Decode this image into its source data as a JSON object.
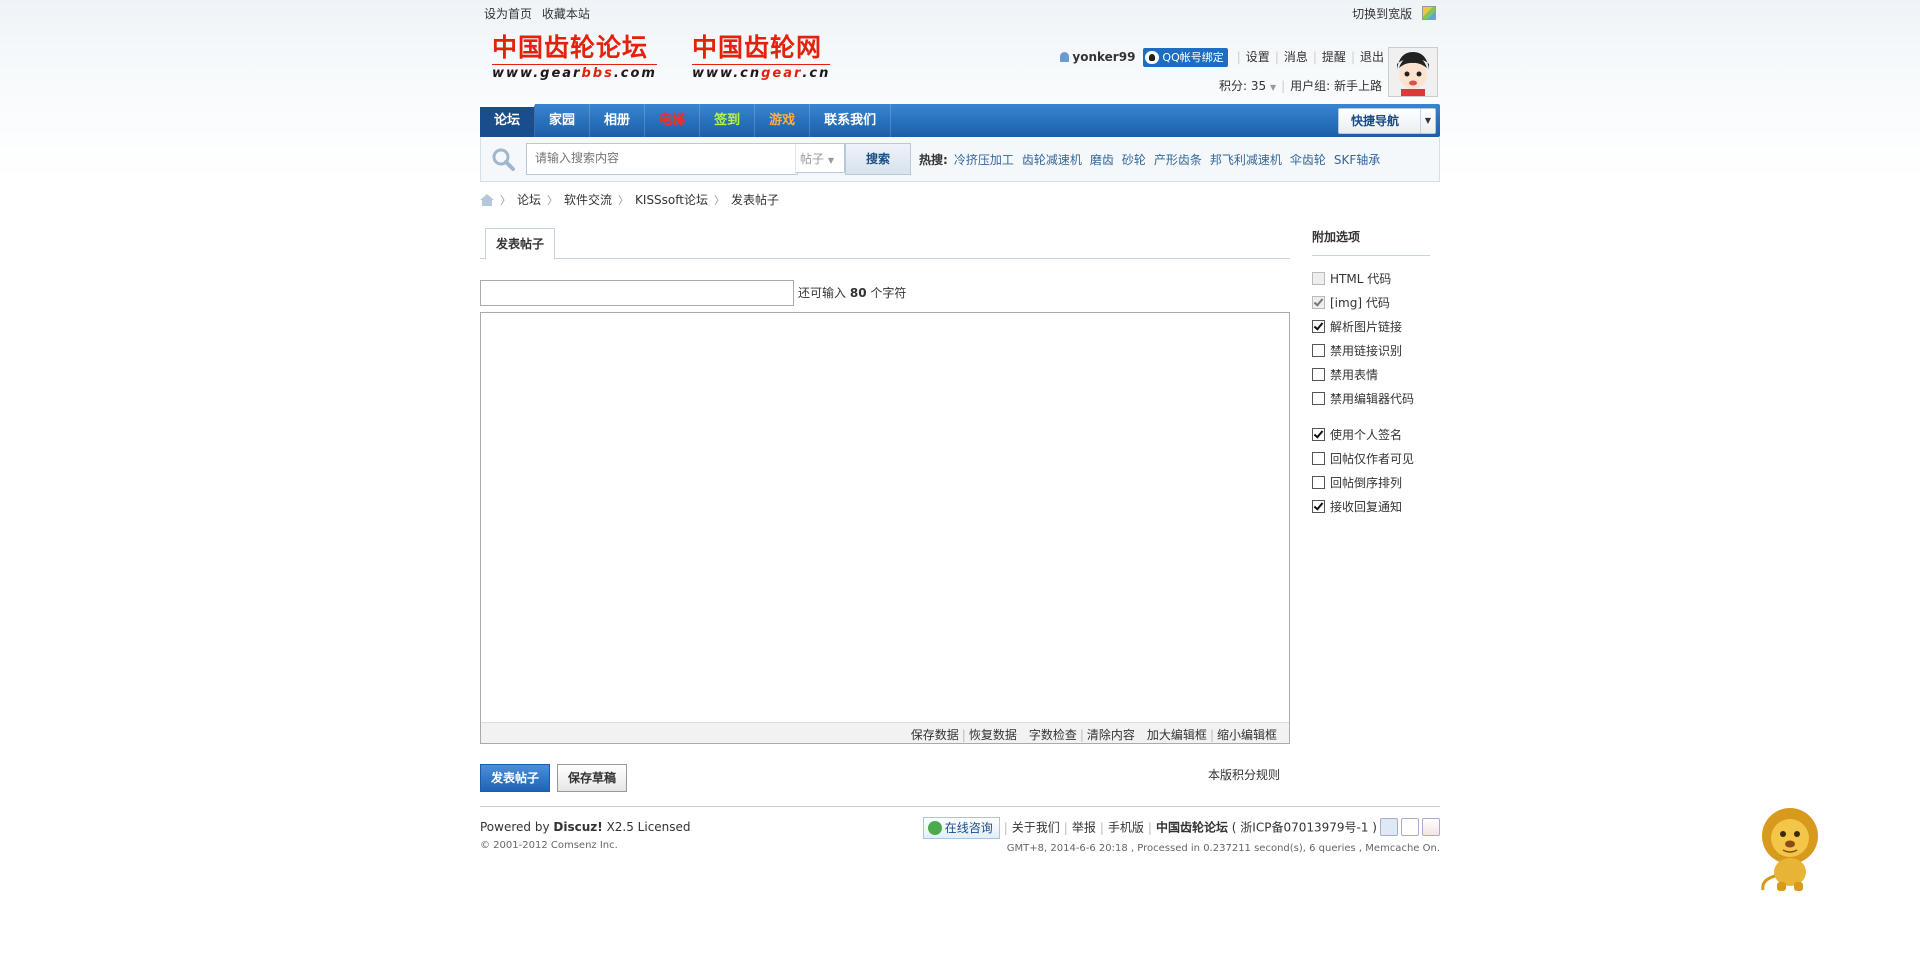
{
  "topbar": {
    "set_home": "设为首页",
    "bookmark": "收藏本站",
    "switch_wide": "切换到宽版"
  },
  "logos": {
    "forum": {
      "cn": "中国齿轮论坛",
      "url_pre": "www.gear",
      "url_hl": "bbs",
      "url_post": ".com"
    },
    "site": {
      "cn": "中国齿轮网",
      "url_pre": "www.cn",
      "url_hl": "gear",
      "url_post": ".cn"
    }
  },
  "user": {
    "name": "yonker99",
    "qq_bind": "QQ帐号绑定",
    "settings": "设置",
    "messages": "消息",
    "reminders": "提醒",
    "logout": "退出",
    "points": "积分: 35",
    "group": "用户组: 新手上路"
  },
  "nav": {
    "items": [
      "论坛",
      "家园",
      "相册",
      "电梯",
      "签到",
      "游戏",
      "联系我们"
    ],
    "quick_nav": "快捷导航"
  },
  "search": {
    "placeholder": "请输入搜索内容",
    "type": "帖子",
    "button": "搜索",
    "hot_label": "热搜:",
    "hot_terms": [
      "冷挤压加工",
      "齿轮减速机",
      "磨齿",
      "砂轮",
      "产形齿条",
      "邦飞利减速机",
      "伞齿轮",
      "SKF轴承"
    ]
  },
  "breadcrumb": [
    "论坛",
    "软件交流",
    "KISSsoft论坛",
    "发表帖子"
  ],
  "editor": {
    "tab": "发表帖子",
    "subject_value": "",
    "remain_pre": "还可输入",
    "remain_count": "80",
    "remain_post": "个字符",
    "tools": [
      "保存数据",
      "恢复数据",
      "字数检查",
      "清除内容",
      "加大编辑框",
      "缩小编辑框"
    ],
    "post_button": "发表帖子",
    "draft_button": "保存草稿",
    "rules_link": "本版积分规则"
  },
  "options": {
    "title": "附加选项",
    "items": [
      {
        "label": "HTML 代码",
        "checked": false,
        "disabled": true
      },
      {
        "label": "[img] 代码",
        "checked": true,
        "disabled": true
      },
      {
        "label": "解析图片链接",
        "checked": true,
        "disabled": false
      },
      {
        "label": "禁用链接识别",
        "checked": false,
        "disabled": false
      },
      {
        "label": "禁用表情",
        "checked": false,
        "disabled": false
      },
      {
        "label": "禁用编辑器代码",
        "checked": false,
        "disabled": false
      },
      {
        "label": "使用个人签名",
        "checked": true,
        "disabled": false
      },
      {
        "label": "回帖仅作者可见",
        "checked": false,
        "disabled": false
      },
      {
        "label": "回帖倒序排列",
        "checked": false,
        "disabled": false
      },
      {
        "label": "接收回复通知",
        "checked": true,
        "disabled": false
      }
    ]
  },
  "footer": {
    "powered_pre": "Powered by",
    "powered_brand": "Discuz!",
    "powered_post": "X2.5 Licensed",
    "copyright": "© 2001-2012 Comsenz Inc.",
    "online": "在线咨询",
    "about": "关于我们",
    "report": "举报",
    "mobile": "手机版",
    "site_name": "中国齿轮论坛",
    "icp": "( 浙ICP备07013979号-1 )",
    "gmt": "GMT+8, 2014-6-6 20:18 , Processed in 0.237211 second(s), 6 queries , Memcache On."
  },
  "colors": {
    "nav_blue": "#1b5ea8",
    "logo_red": "#e3210d",
    "link_blue": "#336699"
  }
}
